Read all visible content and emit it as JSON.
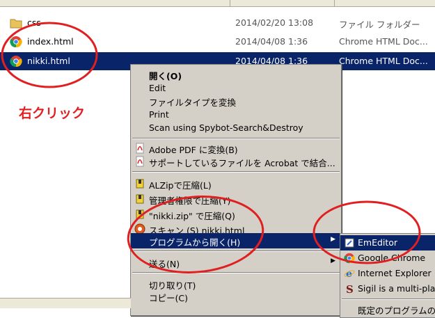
{
  "files": [
    {
      "name": "css",
      "date": "2014/02/20 13:08",
      "type": "ファイル フォルダー",
      "icon": "folder-icon",
      "selected": false
    },
    {
      "name": "index.html",
      "date": "2014/04/08 1:36",
      "type": "Chrome HTML Doc...",
      "icon": "chrome-icon",
      "selected": false
    },
    {
      "name": "nikki.html",
      "date": "2014/04/08 1:36",
      "type": "Chrome HTML Doc...",
      "icon": "chrome-icon",
      "selected": true
    }
  ],
  "annotation": "右クリック",
  "context_menu": {
    "items": [
      {
        "label": "開く(O)",
        "bold": true
      },
      {
        "label": "Edit"
      },
      {
        "label": "ファイルタイプを変換"
      },
      {
        "label": "Print"
      },
      {
        "label": "Scan using Spybot-Search&Destroy"
      },
      {
        "label": "Adobe PDF に変換(B)",
        "icon": "pdf-icon"
      },
      {
        "label": "サポートしているファイルを Acrobat で結合...",
        "icon": "pdf-icon"
      },
      {
        "label": "ALZipで圧縮(L)",
        "icon": "alzip-icon"
      },
      {
        "label": "管理者権限で圧縮(Y)",
        "icon": "alzip-icon"
      },
      {
        "label": "\"nikki.zip\" で圧縮(Q)",
        "icon": "alzip-icon"
      },
      {
        "label": "スキャン (S) nikki.html",
        "icon": "scan-icon"
      },
      {
        "label": "プログラムから開く(H)",
        "highlighted": true,
        "submenu": true
      },
      {
        "label": "送る(N)",
        "submenu": true
      },
      {
        "label": "切り取り(T)"
      },
      {
        "label": "コピー(C)"
      }
    ]
  },
  "open_with_submenu": {
    "items": [
      {
        "label": "EmEditor",
        "icon": "emeditor-icon",
        "highlighted": true
      },
      {
        "label": "Google Chrome",
        "icon": "chrome-icon"
      },
      {
        "label": "Internet Explorer",
        "icon": "ie-icon"
      },
      {
        "label": "Sigil is a multi-pla",
        "icon": "sigil-icon"
      },
      {
        "label": "既定のプログラムの"
      }
    ]
  },
  "colors": {
    "selection": "#0a246a",
    "menu_bg": "#d4d0c8",
    "annotation_red": "#e02020"
  }
}
